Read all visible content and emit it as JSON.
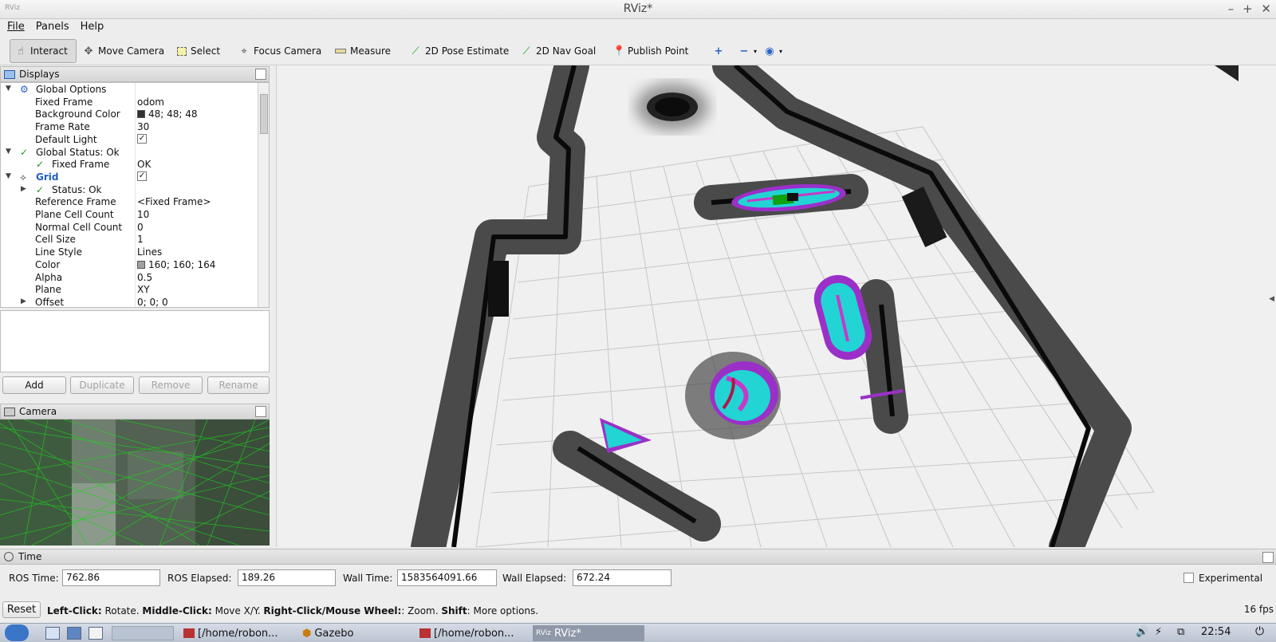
{
  "window": {
    "title": "RViz*"
  },
  "menu": [
    "File",
    "Panels",
    "Help"
  ],
  "toolbar": {
    "tools": [
      {
        "label": "Interact",
        "icon": "hand-pointer-icon",
        "active": true
      },
      {
        "label": "Move Camera",
        "icon": "move-camera-icon"
      },
      {
        "label": "Select",
        "icon": "select-box-icon"
      },
      {
        "label": "Focus Camera",
        "icon": "focus-target-icon"
      },
      {
        "label": "Measure",
        "icon": "ruler-icon"
      },
      {
        "label": "2D Pose Estimate",
        "icon": "green-arrow-icon"
      },
      {
        "label": "2D Nav Goal",
        "icon": "green-arrow-icon"
      },
      {
        "label": "Publish Point",
        "icon": "map-pin-icon"
      }
    ],
    "extra_icons": [
      "plus-icon",
      "minus-icon",
      "eye-icon"
    ]
  },
  "displays": {
    "title": "Displays",
    "rows": [
      {
        "label": "Global Options",
        "value": "",
        "depth": 1,
        "expand": "open",
        "icon": "gear-icon",
        "name": "tree-row-global-options"
      },
      {
        "label": "Fixed Frame",
        "value": "odom",
        "depth": 2,
        "name": "tree-row-fixed-frame"
      },
      {
        "label": "Background Color",
        "value": "48; 48; 48",
        "depth": 2,
        "swatch": "#303030",
        "name": "tree-row-background-color"
      },
      {
        "label": "Frame Rate",
        "value": "30",
        "depth": 2,
        "name": "tree-row-frame-rate"
      },
      {
        "label": "Default Light",
        "value": "",
        "depth": 2,
        "checkbox": true,
        "name": "tree-row-default-light"
      },
      {
        "label": "Global Status: Ok",
        "value": "",
        "depth": 1,
        "expand": "open",
        "icon": "check-icon",
        "name": "tree-row-global-status"
      },
      {
        "label": "Fixed Frame",
        "value": "OK",
        "depth": 2,
        "icon": "check-icon",
        "name": "tree-row-fixed-frame-status"
      },
      {
        "label": "Grid",
        "value": "",
        "depth": 1,
        "expand": "open",
        "icon": "grid-icon",
        "checkbox": true,
        "bold": true,
        "name": "tree-row-grid"
      },
      {
        "label": "Status: Ok",
        "value": "",
        "depth": 2,
        "expand": "closed",
        "icon": "check-icon",
        "name": "tree-row-grid-status"
      },
      {
        "label": "Reference Frame",
        "value": "<Fixed Frame>",
        "depth": 2,
        "name": "tree-row-reference-frame"
      },
      {
        "label": "Plane Cell Count",
        "value": "10",
        "depth": 2,
        "name": "tree-row-plane-cell-count"
      },
      {
        "label": "Normal Cell Count",
        "value": "0",
        "depth": 2,
        "name": "tree-row-normal-cell-count"
      },
      {
        "label": "Cell Size",
        "value": "1",
        "depth": 2,
        "name": "tree-row-cell-size"
      },
      {
        "label": "Line Style",
        "value": "Lines",
        "depth": 2,
        "name": "tree-row-line-style"
      },
      {
        "label": "Color",
        "value": "160; 160; 164",
        "depth": 2,
        "swatch": "#a0a0a4",
        "name": "tree-row-color"
      },
      {
        "label": "Alpha",
        "value": "0.5",
        "depth": 2,
        "name": "tree-row-alpha"
      },
      {
        "label": "Plane",
        "value": "XY",
        "depth": 2,
        "name": "tree-row-plane"
      },
      {
        "label": "Offset",
        "value": "0; 0; 0",
        "depth": 2,
        "expand": "closed",
        "name": "tree-row-offset"
      }
    ],
    "buttons": {
      "add": "Add",
      "duplicate": "Duplicate",
      "remove": "Remove",
      "rename": "Rename"
    }
  },
  "camera_panel": {
    "title": "Camera"
  },
  "time_panel": {
    "title": "Time",
    "ros_time_label": "ROS Time:",
    "ros_time": "762.86",
    "ros_elapsed_label": "ROS Elapsed:",
    "ros_elapsed": "189.26",
    "wall_time_label": "Wall Time:",
    "wall_time": "1583564091.66",
    "wall_elapsed_label": "Wall Elapsed:",
    "wall_elapsed": "672.24",
    "experimental": "Experimental"
  },
  "statusbar": {
    "reset": "Reset",
    "parts": [
      {
        "text": "Left-Click:",
        "bold": true
      },
      {
        "text": " Rotate. "
      },
      {
        "text": "Middle-Click:",
        "bold": true
      },
      {
        "text": " Move X/Y. "
      },
      {
        "text": "Right-Click/Mouse Wheel:",
        "bold": true
      },
      {
        "text": ": Zoom. "
      },
      {
        "text": "Shift",
        "bold": true
      },
      {
        "text": ": More options."
      }
    ],
    "fps": "16 fps"
  },
  "taskbar": {
    "items": [
      {
        "label": "[/home/robon...",
        "icon": "terminal-icon"
      },
      {
        "label": "Gazebo",
        "icon": "gazebo-icon"
      },
      {
        "label": "[/home/robon...",
        "icon": "terminal-icon"
      },
      {
        "label": "RViz*",
        "icon": "rviz-icon",
        "active": true
      }
    ],
    "clock": "22:54"
  },
  "colors": {
    "accent": "#1f5fbf",
    "grid": "#a0a0a4",
    "costmap_cyan": "#22d4d4",
    "costmap_purple": "#9b30c8"
  }
}
